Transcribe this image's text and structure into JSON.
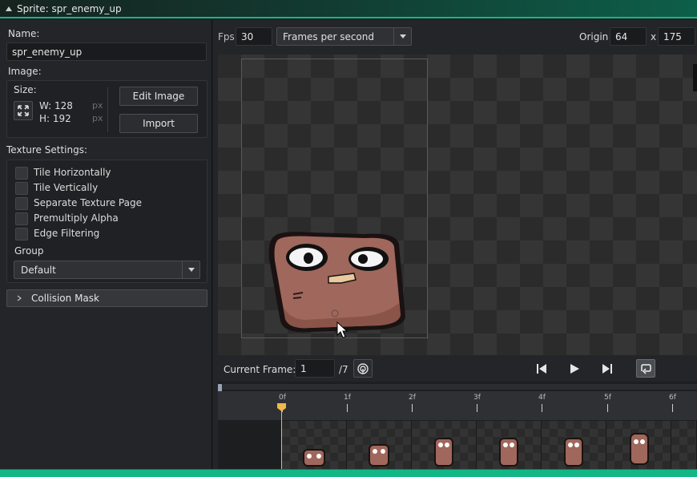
{
  "window": {
    "title": "Sprite: spr_enemy_up"
  },
  "left": {
    "name_label": "Name:",
    "name_value": "spr_enemy_up",
    "image_label": "Image:",
    "size_label": "Size:",
    "width_text": "W: 128",
    "height_text": "H: 192",
    "unit_w": "px",
    "unit_h": "px",
    "edit_image": "Edit Image",
    "import": "Import",
    "texture_label": "Texture Settings:",
    "checks": [
      {
        "label": "Tile Horizontally",
        "checked": false
      },
      {
        "label": "Tile Vertically",
        "checked": false
      },
      {
        "label": "Separate Texture Page",
        "checked": false
      },
      {
        "label": "Premultiply Alpha",
        "checked": false
      },
      {
        "label": "Edge Filtering",
        "checked": false
      }
    ],
    "group_label": "Group",
    "group_value": "Default",
    "collision_mask": "Collision Mask"
  },
  "toolbar": {
    "fps_label": "Fps",
    "fps_value": "30",
    "fps_mode": "Frames per second",
    "origin_label": "Origin",
    "origin_x": "64",
    "x_sep": "x",
    "origin_y": "175"
  },
  "playback": {
    "current_frame_label": "Current Frame:",
    "current_frame": "1",
    "total_frames": "/7"
  },
  "timeline": {
    "ticks": [
      "0f",
      "1f",
      "2f",
      "3f",
      "4f",
      "5f",
      "6f"
    ]
  },
  "colors": {
    "accent": "#13b785",
    "playhead": "#f0b84a"
  }
}
